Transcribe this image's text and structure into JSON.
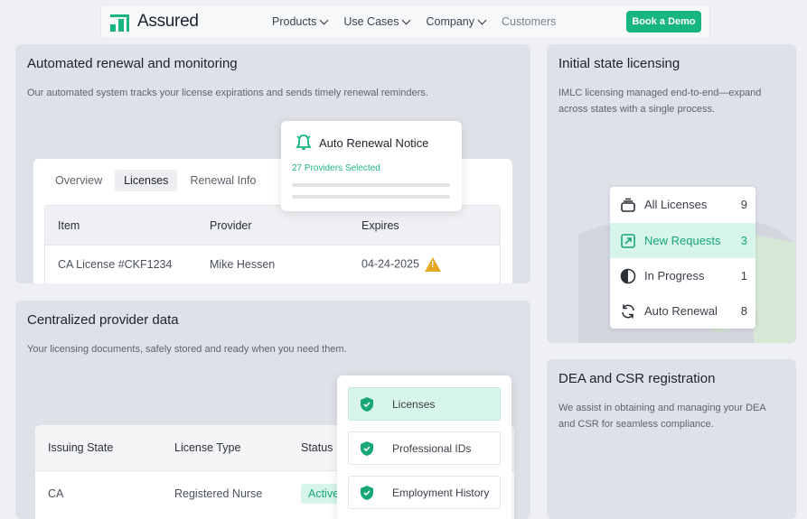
{
  "nav": {
    "logo_text": "Assured",
    "links": [
      "Products",
      "Use Cases",
      "Company",
      "Customers"
    ],
    "cta": "Book a Demo"
  },
  "renewal": {
    "title": "Automated renewal and monitoring",
    "desc": "Our automated system tracks your license expirations and sends timely renewal reminders.",
    "tabs": [
      "Overview",
      "Licenses",
      "Renewal Info"
    ],
    "table": {
      "headers": [
        "Item",
        "Provider",
        "Expires"
      ],
      "row": [
        "CA License #CKF1234",
        "Mike Hessen",
        "04-24-2025"
      ]
    },
    "notice": {
      "title": "Auto Renewal Notice",
      "subtitle": "27 Providers Selected"
    }
  },
  "licensing": {
    "title": "Initial state licensing",
    "desc_line1": "IMLC licensing managed end-to-end—expand",
    "desc_line2": "across states with a single process.",
    "items": [
      {
        "label": "All Licenses",
        "count": "9",
        "icon": "stack-icon"
      },
      {
        "label": "New Requests",
        "count": "3",
        "icon": "new-request-icon"
      },
      {
        "label": "In Progress",
        "count": "1",
        "icon": "progress-icon"
      },
      {
        "label": "Auto Renewal",
        "count": "8",
        "icon": "refresh-icon"
      }
    ]
  },
  "provider": {
    "title": "Centralized provider data",
    "desc": "Your licensing documents, safely stored and ready when you need them.",
    "table": {
      "headers": [
        "Issuing State",
        "License Type",
        "Status"
      ],
      "row": [
        "CA",
        "Registered Nurse",
        "Active"
      ]
    },
    "docs": [
      "Licenses",
      "Professional IDs",
      "Employment History"
    ]
  },
  "dea": {
    "title": "DEA and CSR registration",
    "desc_line1": "We assist in obtaining and managing your DEA",
    "desc_line2": "and CSR for seamless compliance."
  },
  "colors": {
    "accent": "#17b57f",
    "accent_light": "#d7f5ea",
    "card_bg": "#dfe1e8",
    "warning": "#e6a723"
  }
}
